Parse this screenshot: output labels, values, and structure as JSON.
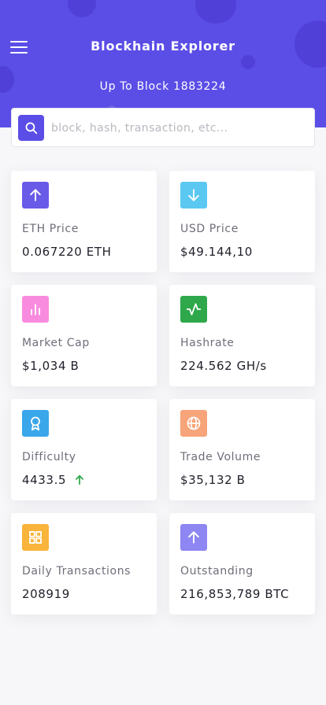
{
  "header": {
    "title": "Blockhain Explorer",
    "subtitle": "Up To Block 1883224",
    "bg_color": "#5b4ee6"
  },
  "search": {
    "placeholder": "block, hash, transaction, etc...",
    "value": ""
  },
  "cards": [
    {
      "label": "ETH Price",
      "value": "0.067220 ETH",
      "icon": "arrow-up-icon",
      "color": "#6a5ae8"
    },
    {
      "label": "USD Price",
      "value": "$49.144,10",
      "icon": "arrow-down-icon",
      "color": "#5bc8f2"
    },
    {
      "label": "Market Cap",
      "value": "$1,034 B",
      "icon": "bar-chart-icon",
      "color": "#f98bdf"
    },
    {
      "label": "Hashrate",
      "value": "224.562 GH/s",
      "icon": "activity-icon",
      "color": "#2ea84a"
    },
    {
      "label": "Difficulty",
      "value": "4433.5",
      "icon": "award-icon",
      "color": "#3aa7ea",
      "trend": "up",
      "trend_color": "#2ea84a"
    },
    {
      "label": "Trade Volume",
      "value": "$35,132 B",
      "icon": "globe-icon",
      "color": "#f7a47a"
    },
    {
      "label": "Daily Transactions",
      "value": "208919",
      "icon": "grid-icon",
      "color": "#f9b43c"
    },
    {
      "label": "Outstanding",
      "value": "216,853,789 BTC",
      "icon": "arrow-up-icon",
      "color": "#8e86f2"
    }
  ]
}
